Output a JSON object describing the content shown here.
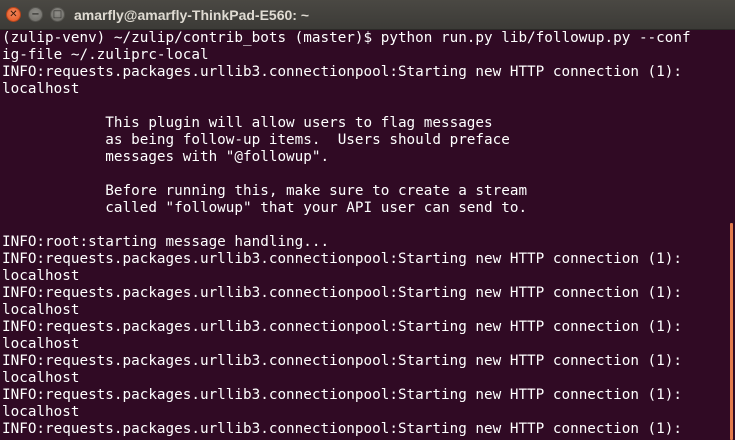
{
  "window": {
    "title": "amarfly@amarfly-ThinkPad-E560: ~",
    "close_glyph": "✕",
    "min_glyph": "−",
    "max_glyph": "□"
  },
  "terminal": {
    "lines": [
      "(zulip-venv) ~/zulip/contrib_bots (master)$ python run.py lib/followup.py --conf",
      "ig-file ~/.zuliprc-local",
      "INFO:requests.packages.urllib3.connectionpool:Starting new HTTP connection (1):",
      "localhost",
      "",
      "            This plugin will allow users to flag messages",
      "            as being follow-up items.  Users should preface",
      "            messages with \"@followup\".",
      "",
      "            Before running this, make sure to create a stream",
      "            called \"followup\" that your API user can send to.",
      "",
      "INFO:root:starting message handling...",
      "INFO:requests.packages.urllib3.connectionpool:Starting new HTTP connection (1):",
      "localhost",
      "INFO:requests.packages.urllib3.connectionpool:Starting new HTTP connection (1):",
      "localhost",
      "INFO:requests.packages.urllib3.connectionpool:Starting new HTTP connection (1):",
      "localhost",
      "INFO:requests.packages.urllib3.connectionpool:Starting new HTTP connection (1):",
      "localhost",
      "INFO:requests.packages.urllib3.connectionpool:Starting new HTTP connection (1):",
      "localhost",
      "INFO:requests.packages.urllib3.connectionpool:Starting new HTTP connection (1):"
    ]
  },
  "colors": {
    "terminal_bg": "#300a24",
    "text": "#ffffff",
    "titlebar": "#3c3b37",
    "close_button": "#e2521d",
    "scroll_thumb": "#e27a4c"
  }
}
